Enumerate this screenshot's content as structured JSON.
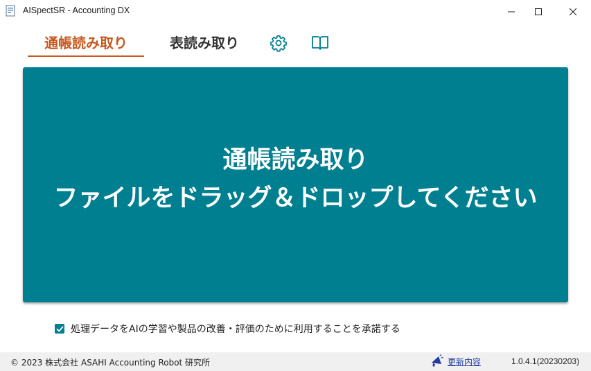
{
  "window": {
    "title": "AISpectSR - Accounting DX"
  },
  "tabs": [
    {
      "label": "通帳読み取り",
      "active": true
    },
    {
      "label": "表読み取り",
      "active": false
    }
  ],
  "toolbar_icons": [
    "gear-icon",
    "book-icon"
  ],
  "dropzone": {
    "line1": "通帳読み取り",
    "line2": "ファイルをドラッグ＆ドロップしてください"
  },
  "consent": {
    "checked": true,
    "label": "処理データをAIの学習や製品の改善・評価のために利用することを承諾する"
  },
  "statusbar": {
    "copyright": "© 2023 株式会社 ASAHI Accounting Robot 研究所",
    "update_label": "更新内容",
    "version": "1.0.4.1(20230203)"
  },
  "colors": {
    "accent_teal": "#007f91",
    "active_tab": "#c8581c",
    "link_blue": "#1f3b9e"
  }
}
